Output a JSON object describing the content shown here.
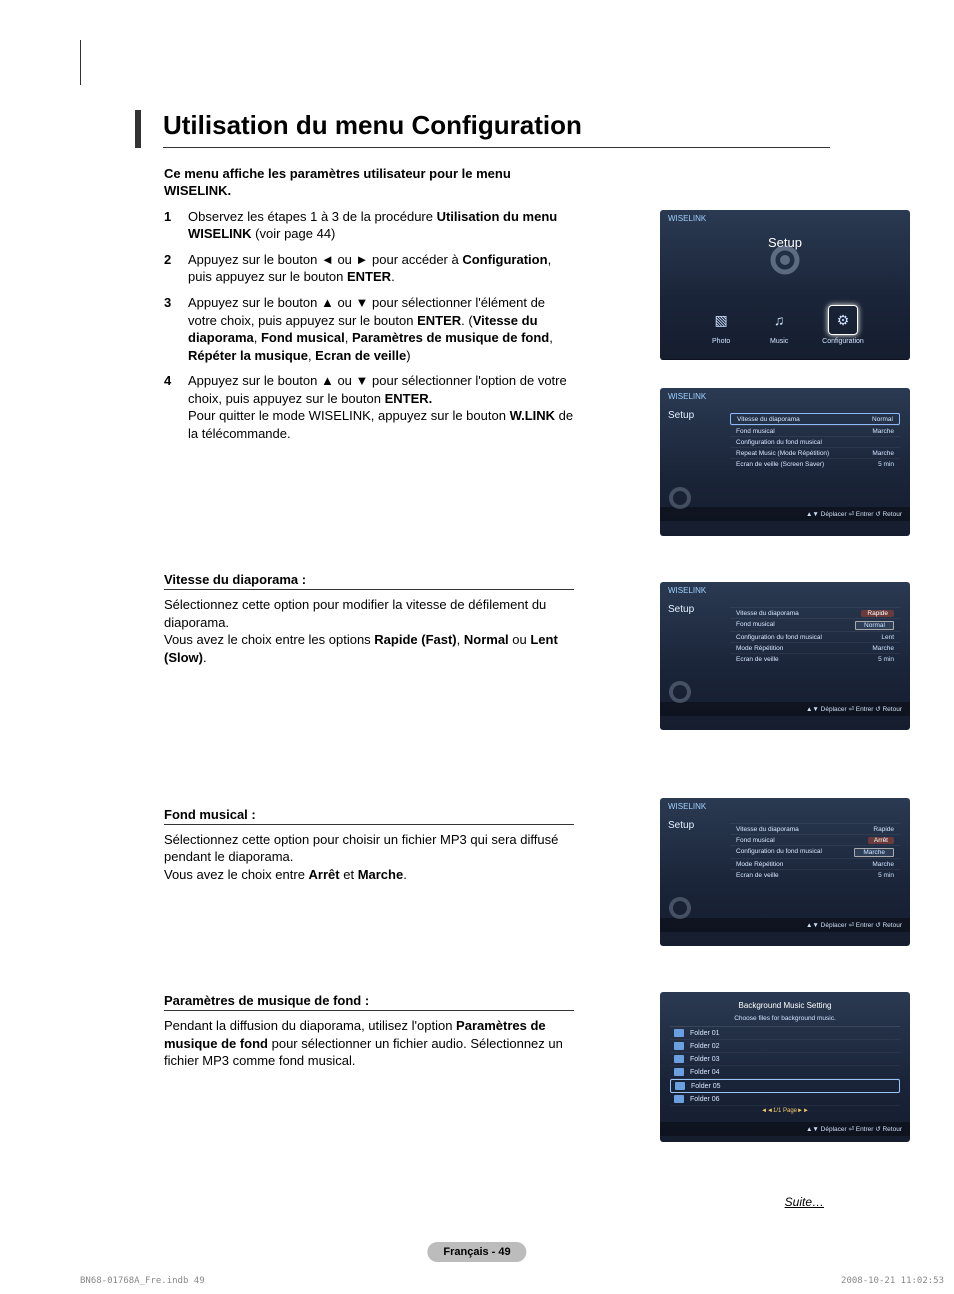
{
  "title": "Utilisation du menu Configuration",
  "intro": "Ce menu affiche les paramètres utilisateur pour le menu WISELINK.",
  "steps": [
    {
      "n": "1",
      "html": "Observez les étapes 1 à 3 de la procédure <b>Utilisation du menu WISELINK</b> (voir page 44)"
    },
    {
      "n": "2",
      "html": "Appuyez sur le bouton ◄ ou ► pour accéder à <b>Configuration</b>, puis appuyez sur le bouton <b>ENTER</b>."
    },
    {
      "n": "3",
      "html": "Appuyez sur le bouton ▲ ou ▼ pour sélectionner l'élément de votre choix, puis appuyez sur le bouton <b>ENTER</b>. (<b>Vitesse du diaporama</b>, <b>Fond musical</b>, <b>Paramètres de musique de fond</b>, <b>Répéter la musique</b>, <b>Ecran de veille</b>)"
    },
    {
      "n": "4",
      "html": "Appuyez sur le bouton ▲ ou ▼ pour sélectionner l'option de votre choix, puis appuyez sur le bouton <b>ENTER.</b><br>Pour quitter le mode WISELINK, appuyez sur le bouton <b>W.LINK</b> de la télécommande."
    }
  ],
  "sections": [
    {
      "heading": "Vitesse du diaporama :",
      "body": "Sélectionnez cette option pour modifier la vitesse de défilement du diaporama.<br>Vous avez le choix entre les options <b>Rapide (Fast)</b>, <b>Normal</b> ou <b>Lent (Slow)</b>."
    },
    {
      "heading": "Fond musical :",
      "body": "Sélectionnez cette option pour choisir un fichier MP3 qui sera diffusé pendant le diaporama.<br>Vous avez le choix entre <b>Arrêt</b> et <b>Marche</b>."
    },
    {
      "heading": "Paramètres de musique de fond :",
      "body": "Pendant la diffusion du diaporama, utilisez l'option <b>Paramètres de musique de fond</b> pour sélectionner un fichier audio. Sélectionnez un fichier MP3 comme fond musical."
    }
  ],
  "thumb_footer": "Déplacer   ⏎ Entrer   ↺ Retour",
  "thumb1": {
    "brand": "WISELINK",
    "title": "Setup",
    "icons": [
      {
        "label": "Photo"
      },
      {
        "label": "Music"
      },
      {
        "label": "Configuration"
      }
    ],
    "footer_prefix": "◄ ►"
  },
  "thumb2": {
    "brand": "WISELINK",
    "side": "Setup",
    "rows": [
      {
        "label": "Vitesse du diaporama",
        "value": "Normal",
        "boxed": true
      },
      {
        "label": "Fond musical",
        "value": "Marche"
      },
      {
        "label": "Configuration du fond musical",
        "value": ""
      },
      {
        "label": "Repeat Music (Mode Répétition)",
        "value": "Marche"
      },
      {
        "label": "Ecran de veille (Screen Saver)",
        "value": "5 min"
      }
    ]
  },
  "thumb3": {
    "brand": "WISELINK",
    "side": "Setup",
    "rows": [
      {
        "label": "Vitesse du diaporama",
        "value": "Rapide",
        "hl": true
      },
      {
        "label": "Fond musical",
        "value": "Normal",
        "dd": true
      },
      {
        "label": "Configuration du fond musical",
        "value": "Lent"
      },
      {
        "label": "Mode Répétition",
        "value": "Marche"
      },
      {
        "label": "Ecran de veille",
        "value": "5 min"
      }
    ]
  },
  "thumb4": {
    "brand": "WISELINK",
    "side": "Setup",
    "rows": [
      {
        "label": "Vitesse du diaporama",
        "value": "Rapide"
      },
      {
        "label": "Fond musical",
        "value": "Arrêt",
        "hl": true
      },
      {
        "label": "Configuration du fond musical",
        "value": "Marche",
        "dd": true
      },
      {
        "label": "Mode Répétition",
        "value": "Marche"
      },
      {
        "label": "Ecran de veille",
        "value": "5 min"
      }
    ]
  },
  "thumb5": {
    "title": "Background Music Setting",
    "sub": "Choose files for background music.",
    "folders": [
      "Folder 01",
      "Folder 02",
      "Folder 03",
      "Folder 04",
      "Folder 05",
      "Folder 06"
    ],
    "selected_index": 4,
    "page": "◄◄1/1 Page►►"
  },
  "suite": "Suite…",
  "pagenum": "Français - 49",
  "footer_left": "BN68-01768A_Fre.indb   49",
  "footer_right": "2008-10-21   11:02:53"
}
